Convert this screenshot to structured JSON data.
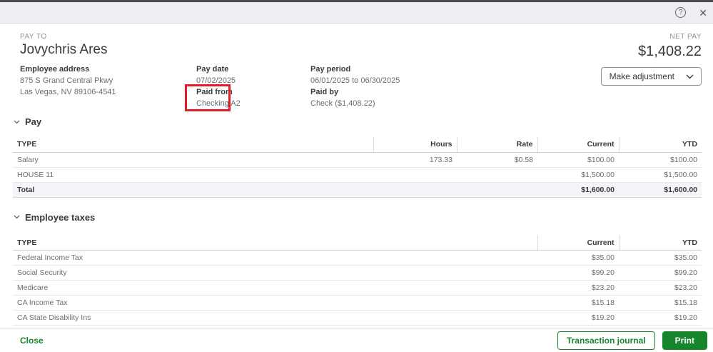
{
  "window": {
    "help_glyph": "?",
    "close_glyph": "✕"
  },
  "header": {
    "pay_to_label": "PAY TO",
    "payee_name": "Jovychris Ares",
    "net_pay_label": "NET PAY",
    "net_pay_amount": "$1,408.22",
    "make_adjustment_label": "Make adjustment"
  },
  "info": {
    "employee_address_label": "Employee address",
    "address_line1": "875 S Grand Central Pkwy",
    "address_line2": "Las Vegas, NV 89106-4541",
    "pay_date_label": "Pay date",
    "pay_date": "07/02/2025",
    "paid_from_label": "Paid from",
    "paid_from": "Checking A2",
    "pay_period_label": "Pay period",
    "pay_period": "06/01/2025 to 06/30/2025",
    "paid_by_label": "Paid by",
    "paid_by": "Check ($1,408.22)"
  },
  "pay_section": {
    "title": "Pay",
    "columns": [
      "TYPE",
      "Hours",
      "Rate",
      "Current",
      "YTD"
    ],
    "rows": [
      {
        "type": "Salary",
        "hours": "173.33",
        "rate": "$0.58",
        "current": "$100.00",
        "ytd": "$100.00"
      },
      {
        "type": "HOUSE 11",
        "hours": "",
        "rate": "",
        "current": "$1,500.00",
        "ytd": "$1,500.00"
      }
    ],
    "total_row": {
      "type": "Total",
      "hours": "",
      "rate": "",
      "current": "$1,600.00",
      "ytd": "$1,600.00"
    }
  },
  "taxes_section": {
    "title": "Employee taxes",
    "columns": [
      "TYPE",
      "Current",
      "YTD"
    ],
    "rows": [
      {
        "type": "Federal Income Tax",
        "current": "$35.00",
        "ytd": "$35.00"
      },
      {
        "type": "Social Security",
        "current": "$99.20",
        "ytd": "$99.20"
      },
      {
        "type": "Medicare",
        "current": "$23.20",
        "ytd": "$23.20"
      },
      {
        "type": "CA Income Tax",
        "current": "$15.18",
        "ytd": "$15.18"
      },
      {
        "type": "CA State Disability Ins",
        "current": "$19.20",
        "ytd": "$19.20"
      }
    ]
  },
  "footer": {
    "close_label": "Close",
    "transaction_journal_label": "Transaction journal",
    "print_label": "Print"
  },
  "colors": {
    "brand_green": "#17852c",
    "annotation_red": "#e01e25",
    "titlebar_bg": "#eceef1",
    "top_strip": "#48494b",
    "text_dark": "#393a3d",
    "text_gray": "#6b6c72",
    "label_gray": "#8d9096",
    "table_border": "#d8dadf",
    "total_row_bg": "#f4f5f8"
  }
}
